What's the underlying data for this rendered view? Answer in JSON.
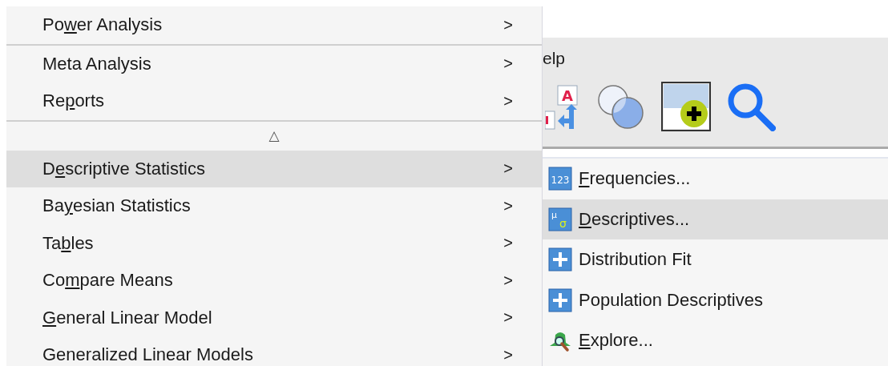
{
  "main_menu": {
    "items": [
      {
        "kind": "item",
        "before": "Po",
        "access_key": "w",
        "after": "er Analysis",
        "arrow": ">",
        "selected": false
      },
      {
        "kind": "separator"
      },
      {
        "kind": "item",
        "before": "Meta Analysis",
        "arrow": ">",
        "selected": false
      },
      {
        "kind": "item",
        "before": "Re",
        "access_key": "p",
        "after": "orts",
        "arrow": ">",
        "selected": false
      },
      {
        "kind": "separator"
      },
      {
        "kind": "scroll_up",
        "symbol": "△"
      },
      {
        "kind": "item",
        "before": "D",
        "access_key": "e",
        "after": "scriptive Statistics",
        "arrow": ">",
        "selected": true
      },
      {
        "kind": "item",
        "before": "Ba",
        "access_key": "y",
        "after": "esian Statistics",
        "arrow": ">",
        "selected": false
      },
      {
        "kind": "item",
        "before": "Ta",
        "access_key": "b",
        "after": "les",
        "arrow": ">",
        "selected": false
      },
      {
        "kind": "item",
        "before": "Co",
        "access_key": "m",
        "after": "pare Means",
        "arrow": ">",
        "selected": false
      },
      {
        "kind": "item",
        "access_key": "G",
        "after": "eneral Linear Model",
        "arrow": ">",
        "selected": false
      },
      {
        "kind": "item",
        "before": "Generalized Linear Models",
        "arrow": ">",
        "selected": false
      }
    ]
  },
  "toolbar": {
    "menu_label": "elp",
    "buttons": [
      {
        "kind": "text_layout",
        "icon_text": "A",
        "selected": false
      },
      {
        "kind": "venn",
        "selected": false
      },
      {
        "kind": "add_point",
        "selected": true
      },
      {
        "kind": "search",
        "selected": false
      }
    ]
  },
  "submenu": {
    "items": [
      {
        "kind": "numbers",
        "icon_text": "123",
        "access_key": "F",
        "after": "requencies...",
        "selected": false
      },
      {
        "kind": "mean_sd",
        "icon_marks": [
          "μ",
          "σ"
        ],
        "access_key": "D",
        "after": "escriptives...",
        "selected": true
      },
      {
        "kind": "plus",
        "before": "Distribution Fit",
        "selected": false
      },
      {
        "kind": "plus",
        "before": "Population Descriptives",
        "selected": false
      },
      {
        "kind": "explore",
        "access_key": "E",
        "after": "xplore...",
        "selected": false
      }
    ]
  }
}
